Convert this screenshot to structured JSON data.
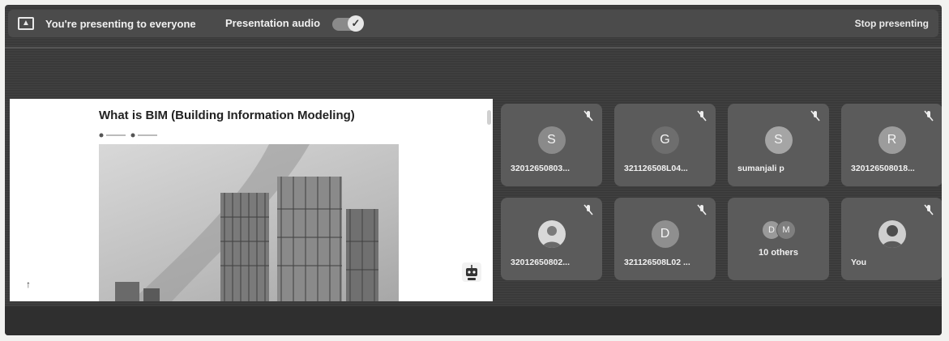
{
  "topbar": {
    "present_icon": "present-screen-icon",
    "presenting_text": "You're presenting to everyone",
    "audio_label": "Presentation audio",
    "audio_toggle_on": true,
    "check_icon": "✓",
    "stop_label": "Stop presenting"
  },
  "slide": {
    "title": "What is BIM (Building Information Modeling)",
    "scroll_up_icon": "↑"
  },
  "participants": [
    {
      "initial": "S",
      "name": "32012650803...",
      "muted": true
    },
    {
      "initial": "G",
      "name": "321126508L04...",
      "muted": true
    },
    {
      "initial": "S",
      "name": "sumanjali p",
      "muted": true
    },
    {
      "initial": "R",
      "name": "320126508018...",
      "muted": true
    },
    {
      "initial": "",
      "name": "32012650802...",
      "muted": true
    },
    {
      "initial": "D",
      "name": "321126508L02 ...",
      "muted": true
    },
    {
      "others": true,
      "initials": [
        "D",
        "M"
      ],
      "name": "10 others"
    },
    {
      "initial": "",
      "name": "You",
      "muted": true
    }
  ],
  "colors": {
    "background": "#3a3a3a",
    "tile": "#5b5b5b",
    "topbar": "#4b4b4b",
    "text": "#f1f1f1"
  }
}
